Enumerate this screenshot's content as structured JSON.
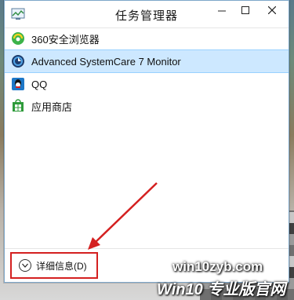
{
  "window": {
    "title": "任务管理器",
    "controls": [
      "minimize-icon",
      "maximize-icon",
      "close-icon"
    ]
  },
  "apps": [
    {
      "label": "360安全浏览器",
      "icon": "360-browser-icon",
      "selected": false
    },
    {
      "label": "Advanced SystemCare 7 Monitor",
      "icon": "advanced-systemcare-icon",
      "selected": true
    },
    {
      "label": "QQ",
      "icon": "qq-icon",
      "selected": false
    },
    {
      "label": "应用商店",
      "icon": "store-icon",
      "selected": false
    }
  ],
  "footer": {
    "details_label": "详细信息(D)"
  },
  "watermark": {
    "url": "win10zyb.com",
    "brand": "Win10 专业版官网"
  },
  "colors": {
    "selected_row": "#cde8ff",
    "highlight_box": "#d42020",
    "window_border": "#7ea7c9"
  }
}
